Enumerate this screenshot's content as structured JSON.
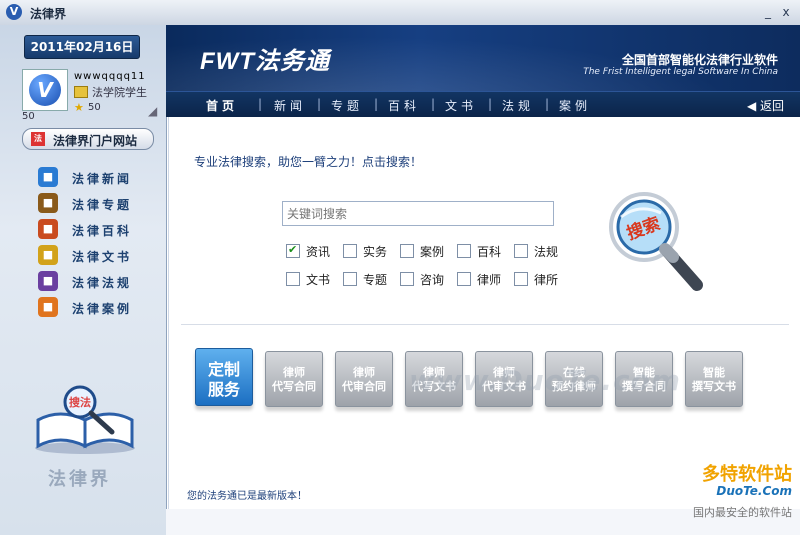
{
  "window": {
    "title": "法律界",
    "close_label": "x",
    "min_label": "_"
  },
  "sidebar": {
    "date": "2011年02月16日",
    "user": {
      "name": "wwwqqqq11",
      "role": "法学院学生",
      "points": "50",
      "level": "50"
    },
    "portal_button": "法律界门户网站",
    "items": [
      {
        "label": "法律新闻",
        "icon": "globe-icon",
        "color": "#2a7bd3"
      },
      {
        "label": "法律专题",
        "icon": "scale-icon",
        "color": "#8a5a1a"
      },
      {
        "label": "法律百科",
        "icon": "book-icon",
        "color": "#c94b1f"
      },
      {
        "label": "法律文书",
        "icon": "document-icon",
        "color": "#d2a21a"
      },
      {
        "label": "法律法规",
        "icon": "bank-icon",
        "color": "#6a3fa0"
      },
      {
        "label": "法律案例",
        "icon": "case-icon",
        "color": "#e0741e"
      }
    ],
    "logo_text": "法律界",
    "search_book_label": "搜法"
  },
  "header": {
    "brand": "FWT法务通",
    "slogan_cn": "全国首部智能化法律行业软件",
    "slogan_en": "The Frist Intelligent legal Software In China"
  },
  "nav": {
    "items": [
      "首页",
      "新闻",
      "专题",
      "百科",
      "文书",
      "法规",
      "案例"
    ],
    "back": "返回"
  },
  "search": {
    "intro": "专业法律搜索，助您一臂之力！点击搜索！",
    "placeholder": "关键词搜索",
    "button_label": "搜索",
    "options": [
      {
        "label": "资讯",
        "checked": true
      },
      {
        "label": "实务",
        "checked": false
      },
      {
        "label": "案例",
        "checked": false
      },
      {
        "label": "百科",
        "checked": false
      },
      {
        "label": "法规",
        "checked": false
      },
      {
        "label": "文书",
        "checked": false
      },
      {
        "label": "专题",
        "checked": false
      },
      {
        "label": "咨询",
        "checked": false
      },
      {
        "label": "律师",
        "checked": false
      },
      {
        "label": "律所",
        "checked": false
      }
    ]
  },
  "services": {
    "main": {
      "line1": "定制",
      "line2": "服务"
    },
    "items": [
      {
        "line1": "律师",
        "line2": "代写合同"
      },
      {
        "line1": "律师",
        "line2": "代审合同"
      },
      {
        "line1": "律师",
        "line2": "代写文书"
      },
      {
        "line1": "律师",
        "line2": "代审文书"
      },
      {
        "line1": "在线",
        "line2": "预约律师"
      },
      {
        "line1": "智能",
        "line2": "撰写合同"
      },
      {
        "line1": "智能",
        "line2": "撰写文书"
      }
    ]
  },
  "status": "您的法务通已是最新版本！",
  "watermarks": {
    "center": "www.DuoTe.com",
    "brand": "多特软件站",
    "brand_en": "DuoTe.Com",
    "tagline": "国内最安全的软件站"
  }
}
